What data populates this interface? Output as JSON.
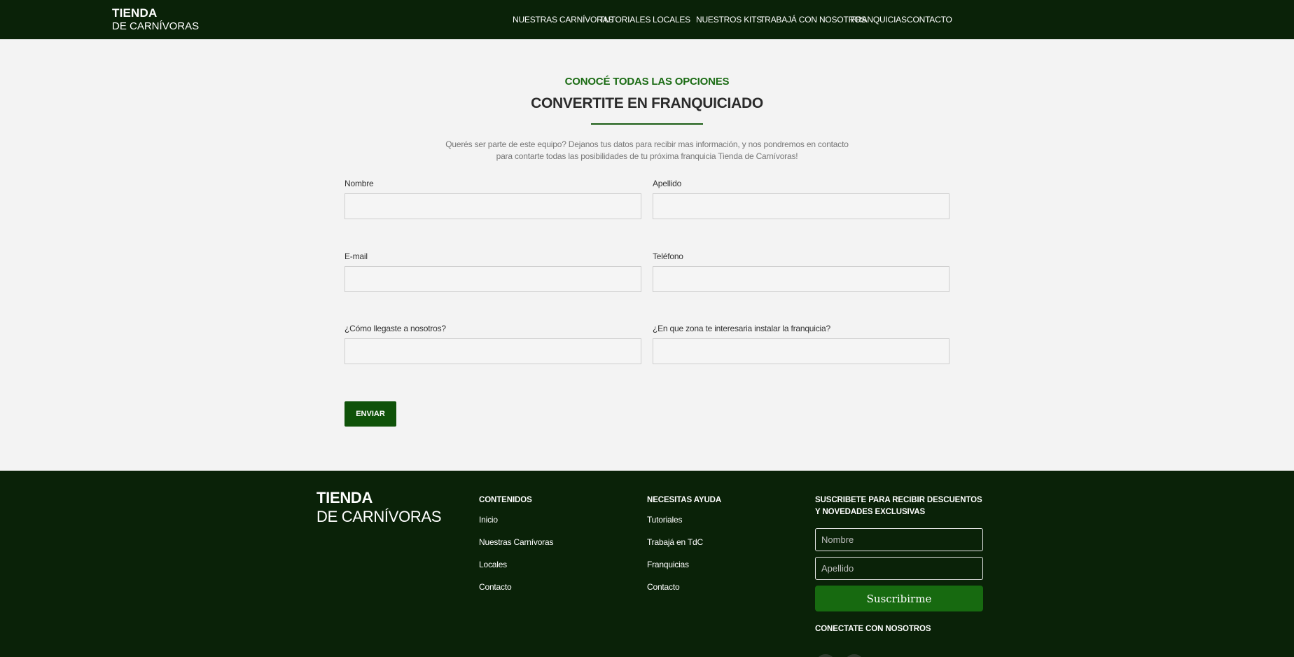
{
  "brand": {
    "line1": "TIENDA",
    "line2": "DE CARNÍVORAS"
  },
  "nav": {
    "items": [
      "NUESTRAS CARNÍVORAS",
      "TUTORIALES",
      "LOCALES",
      "NUESTROS KITS",
      "TRABAJÁ CON NOSOTROS",
      "FRANQUICIAS",
      "CONTACTO"
    ]
  },
  "section": {
    "eyebrow": "CONOCÉ TODAS LAS OPCIONES",
    "title": "CONVERTITE EN FRANQUICIADO",
    "intro": "Querés ser parte de este equipo? Dejanos tus datos para recibir mas información, y nos pondremos en contacto para contarte todas las posibilidades de tu próxima franquicia Tienda de Carnívoras!"
  },
  "form": {
    "fields": [
      {
        "label": "Nombre",
        "value": ""
      },
      {
        "label": "Apellido",
        "value": ""
      },
      {
        "label": "E-mail",
        "value": ""
      },
      {
        "label": "Teléfono",
        "value": ""
      },
      {
        "label": "¿Cómo llegaste a nosotros?",
        "value": ""
      },
      {
        "label": "¿En que zona te interesaria instalar la franquicia?",
        "value": ""
      }
    ],
    "submit_label": "ENVIAR"
  },
  "footer": {
    "brand": {
      "line1": "TIENDA",
      "line2": "DE CARNÍVORAS"
    },
    "contenidos": {
      "heading": "CONTENIDOS",
      "links": [
        "Inicio",
        "Nuestras Carnívoras",
        "Locales",
        "Contacto"
      ]
    },
    "ayuda": {
      "heading": "NECESITAS AYUDA",
      "links": [
        "Tutoriales",
        "Trabajá en TdC",
        "Franquicias",
        "Contacto"
      ]
    },
    "newsletter": {
      "heading": "SUSCRIBETE PARA RECIBIR DESCUENTOS Y NOVEDADES EXCLUSIVAS",
      "nombre_placeholder": "Nombre",
      "apellido_placeholder": "Apellido",
      "button_label": "Suscribirme"
    },
    "social_heading": "CONECTATE CON NOSOTROS"
  },
  "colors": {
    "header_bg": "#0a2208",
    "accent_green": "#1a6b13",
    "button_green": "#0f5209",
    "page_bg": "#f3f3f3"
  }
}
